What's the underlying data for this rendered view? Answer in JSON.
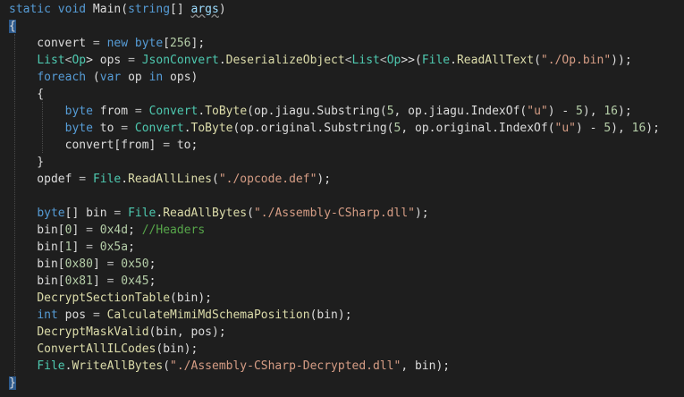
{
  "code": {
    "lines": [
      [
        {
          "t": "static",
          "c": "kw"
        },
        {
          "t": " ",
          "c": "id"
        },
        {
          "t": "void",
          "c": "kw"
        },
        {
          "t": " Main(",
          "c": "id"
        },
        {
          "t": "string",
          "c": "kw"
        },
        {
          "t": "[] ",
          "c": "id"
        },
        {
          "t": "args",
          "c": "pa squig"
        },
        {
          "t": ")",
          "c": "id"
        }
      ],
      [
        {
          "t": "{",
          "c": "id hl"
        }
      ],
      [
        {
          "t": "    convert ",
          "c": "id"
        },
        {
          "t": "=",
          "c": "op"
        },
        {
          "t": " ",
          "c": "id"
        },
        {
          "t": "new",
          "c": "kw"
        },
        {
          "t": " ",
          "c": "id"
        },
        {
          "t": "byte",
          "c": "kw"
        },
        {
          "t": "[",
          "c": "id"
        },
        {
          "t": "256",
          "c": "nu"
        },
        {
          "t": "];",
          "c": "id"
        }
      ],
      [
        {
          "t": "    ",
          "c": "id"
        },
        {
          "t": "List",
          "c": "ty"
        },
        {
          "t": "<",
          "c": "op"
        },
        {
          "t": "Op",
          "c": "ty"
        },
        {
          "t": "> ops ",
          "c": "id"
        },
        {
          "t": "=",
          "c": "op"
        },
        {
          "t": " ",
          "c": "id"
        },
        {
          "t": "JsonConvert",
          "c": "ty"
        },
        {
          "t": ".",
          "c": "id"
        },
        {
          "t": "DeserializeObject",
          "c": "fn"
        },
        {
          "t": "<",
          "c": "op"
        },
        {
          "t": "List",
          "c": "ty"
        },
        {
          "t": "<",
          "c": "op"
        },
        {
          "t": "Op",
          "c": "ty"
        },
        {
          "t": ">>(",
          "c": "id"
        },
        {
          "t": "File",
          "c": "ty"
        },
        {
          "t": ".",
          "c": "id"
        },
        {
          "t": "ReadAllText",
          "c": "fn"
        },
        {
          "t": "(",
          "c": "id"
        },
        {
          "t": "\"./Op.bin\"",
          "c": "st"
        },
        {
          "t": "));",
          "c": "id"
        }
      ],
      [
        {
          "t": "    ",
          "c": "id"
        },
        {
          "t": "foreach",
          "c": "kw"
        },
        {
          "t": " (",
          "c": "id"
        },
        {
          "t": "var",
          "c": "kw"
        },
        {
          "t": " op ",
          "c": "id"
        },
        {
          "t": "in",
          "c": "kw"
        },
        {
          "t": " ops)",
          "c": "id"
        }
      ],
      [
        {
          "t": "    {",
          "c": "id"
        }
      ],
      [
        {
          "t": "        ",
          "c": "id"
        },
        {
          "t": "byte",
          "c": "kw"
        },
        {
          "t": " from ",
          "c": "id"
        },
        {
          "t": "=",
          "c": "op"
        },
        {
          "t": " ",
          "c": "id"
        },
        {
          "t": "Convert",
          "c": "ty"
        },
        {
          "t": ".",
          "c": "id"
        },
        {
          "t": "ToByte",
          "c": "fn"
        },
        {
          "t": "(op.jiagu.Substring(",
          "c": "id"
        },
        {
          "t": "5",
          "c": "nu"
        },
        {
          "t": ", op.jiagu.IndexOf(",
          "c": "id"
        },
        {
          "t": "\"u\"",
          "c": "st"
        },
        {
          "t": ") - ",
          "c": "id"
        },
        {
          "t": "5",
          "c": "nu"
        },
        {
          "t": "), ",
          "c": "id"
        },
        {
          "t": "16",
          "c": "nu"
        },
        {
          "t": ");",
          "c": "id"
        }
      ],
      [
        {
          "t": "        ",
          "c": "id"
        },
        {
          "t": "byte",
          "c": "kw"
        },
        {
          "t": " to ",
          "c": "id"
        },
        {
          "t": "=",
          "c": "op"
        },
        {
          "t": " ",
          "c": "id"
        },
        {
          "t": "Convert",
          "c": "ty"
        },
        {
          "t": ".",
          "c": "id"
        },
        {
          "t": "ToByte",
          "c": "fn"
        },
        {
          "t": "(op.original.Substring(",
          "c": "id"
        },
        {
          "t": "5",
          "c": "nu"
        },
        {
          "t": ", op.original.IndexOf(",
          "c": "id"
        },
        {
          "t": "\"u\"",
          "c": "st"
        },
        {
          "t": ") - ",
          "c": "id"
        },
        {
          "t": "5",
          "c": "nu"
        },
        {
          "t": "), ",
          "c": "id"
        },
        {
          "t": "16",
          "c": "nu"
        },
        {
          "t": ");",
          "c": "id"
        }
      ],
      [
        {
          "t": "        convert[from] ",
          "c": "id"
        },
        {
          "t": "=",
          "c": "op"
        },
        {
          "t": " to;",
          "c": "id"
        }
      ],
      [
        {
          "t": "    }",
          "c": "id"
        }
      ],
      [
        {
          "t": "    opdef ",
          "c": "id"
        },
        {
          "t": "=",
          "c": "op"
        },
        {
          "t": " ",
          "c": "id"
        },
        {
          "t": "File",
          "c": "ty"
        },
        {
          "t": ".",
          "c": "id"
        },
        {
          "t": "ReadAllLines",
          "c": "fn"
        },
        {
          "t": "(",
          "c": "id"
        },
        {
          "t": "\"./opcode.def\"",
          "c": "st"
        },
        {
          "t": ");",
          "c": "id"
        }
      ],
      [
        {
          "t": "",
          "c": "id"
        }
      ],
      [
        {
          "t": "    ",
          "c": "id"
        },
        {
          "t": "byte",
          "c": "kw"
        },
        {
          "t": "[] bin ",
          "c": "id"
        },
        {
          "t": "=",
          "c": "op"
        },
        {
          "t": " ",
          "c": "id"
        },
        {
          "t": "File",
          "c": "ty"
        },
        {
          "t": ".",
          "c": "id"
        },
        {
          "t": "ReadAllBytes",
          "c": "fn"
        },
        {
          "t": "(",
          "c": "id"
        },
        {
          "t": "\"./Assembly-CSharp.dll\"",
          "c": "st"
        },
        {
          "t": ");",
          "c": "id"
        }
      ],
      [
        {
          "t": "    bin[",
          "c": "id"
        },
        {
          "t": "0",
          "c": "nu"
        },
        {
          "t": "] ",
          "c": "id"
        },
        {
          "t": "=",
          "c": "op"
        },
        {
          "t": " ",
          "c": "id"
        },
        {
          "t": "0x4d",
          "c": "nu"
        },
        {
          "t": "; ",
          "c": "id"
        },
        {
          "t": "//Headers",
          "c": "cm"
        }
      ],
      [
        {
          "t": "    bin[",
          "c": "id"
        },
        {
          "t": "1",
          "c": "nu"
        },
        {
          "t": "] ",
          "c": "id"
        },
        {
          "t": "=",
          "c": "op"
        },
        {
          "t": " ",
          "c": "id"
        },
        {
          "t": "0x5a",
          "c": "nu"
        },
        {
          "t": ";",
          "c": "id"
        }
      ],
      [
        {
          "t": "    bin[",
          "c": "id"
        },
        {
          "t": "0x80",
          "c": "nu"
        },
        {
          "t": "] ",
          "c": "id"
        },
        {
          "t": "=",
          "c": "op"
        },
        {
          "t": " ",
          "c": "id"
        },
        {
          "t": "0x50",
          "c": "nu"
        },
        {
          "t": ";",
          "c": "id"
        }
      ],
      [
        {
          "t": "    bin[",
          "c": "id"
        },
        {
          "t": "0x81",
          "c": "nu"
        },
        {
          "t": "] ",
          "c": "id"
        },
        {
          "t": "=",
          "c": "op"
        },
        {
          "t": " ",
          "c": "id"
        },
        {
          "t": "0x45",
          "c": "nu"
        },
        {
          "t": ";",
          "c": "id"
        }
      ],
      [
        {
          "t": "    ",
          "c": "id"
        },
        {
          "t": "DecryptSectionTable",
          "c": "fn"
        },
        {
          "t": "(bin);",
          "c": "id"
        }
      ],
      [
        {
          "t": "    ",
          "c": "id"
        },
        {
          "t": "int",
          "c": "kw"
        },
        {
          "t": " pos ",
          "c": "id"
        },
        {
          "t": "=",
          "c": "op"
        },
        {
          "t": " ",
          "c": "id"
        },
        {
          "t": "CalculateMimiMdSchemaPosition",
          "c": "fn"
        },
        {
          "t": "(bin);",
          "c": "id"
        }
      ],
      [
        {
          "t": "    ",
          "c": "id"
        },
        {
          "t": "DecryptMaskValid",
          "c": "fn"
        },
        {
          "t": "(bin, pos);",
          "c": "id"
        }
      ],
      [
        {
          "t": "    ",
          "c": "id"
        },
        {
          "t": "ConvertAllILCodes",
          "c": "fn"
        },
        {
          "t": "(bin);",
          "c": "id"
        }
      ],
      [
        {
          "t": "    ",
          "c": "id"
        },
        {
          "t": "File",
          "c": "ty"
        },
        {
          "t": ".",
          "c": "id"
        },
        {
          "t": "WriteAllBytes",
          "c": "fn"
        },
        {
          "t": "(",
          "c": "id"
        },
        {
          "t": "\"./Assembly-CSharp-Decrypted.dll\"",
          "c": "st"
        },
        {
          "t": ", bin);",
          "c": "id"
        }
      ],
      [
        {
          "t": "}",
          "c": "id hl"
        }
      ]
    ]
  }
}
